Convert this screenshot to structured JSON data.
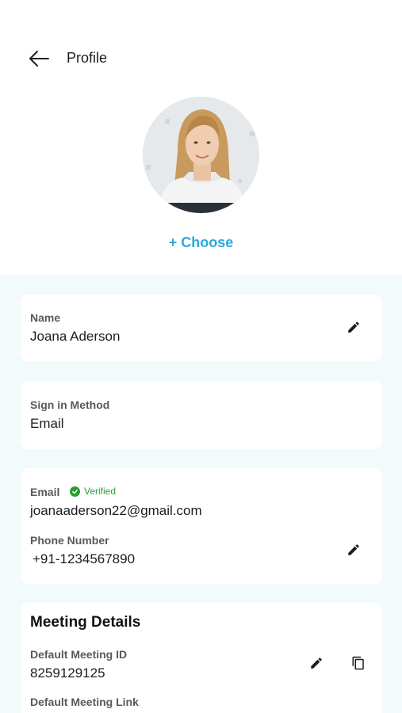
{
  "header": {
    "title": "Profile",
    "choose_label": "+ Choose"
  },
  "name_card": {
    "label": "Name",
    "value": "Joana Aderson"
  },
  "signin_card": {
    "label": "Sign in Method",
    "value": "Email"
  },
  "contact_card": {
    "email_label": "Email",
    "verified_label": "Verified",
    "email_value": "joanaaderson22@gmail.com",
    "phone_label": "Phone Number",
    "phone_value": "+91-1234567890"
  },
  "meeting_card": {
    "title": "Meeting Details",
    "meeting_id_label": "Default Meeting ID",
    "meeting_id_value": "8259129125",
    "meeting_link_label": "Default Meeting Link"
  },
  "icons": {
    "back": "arrow-left-icon",
    "edit": "pencil-icon",
    "copy": "copy-icon",
    "verified": "check-circle-icon"
  },
  "colors": {
    "accent": "#2aa9dc",
    "verified": "#2a9d2f",
    "content_bg": "#f2fafc"
  }
}
